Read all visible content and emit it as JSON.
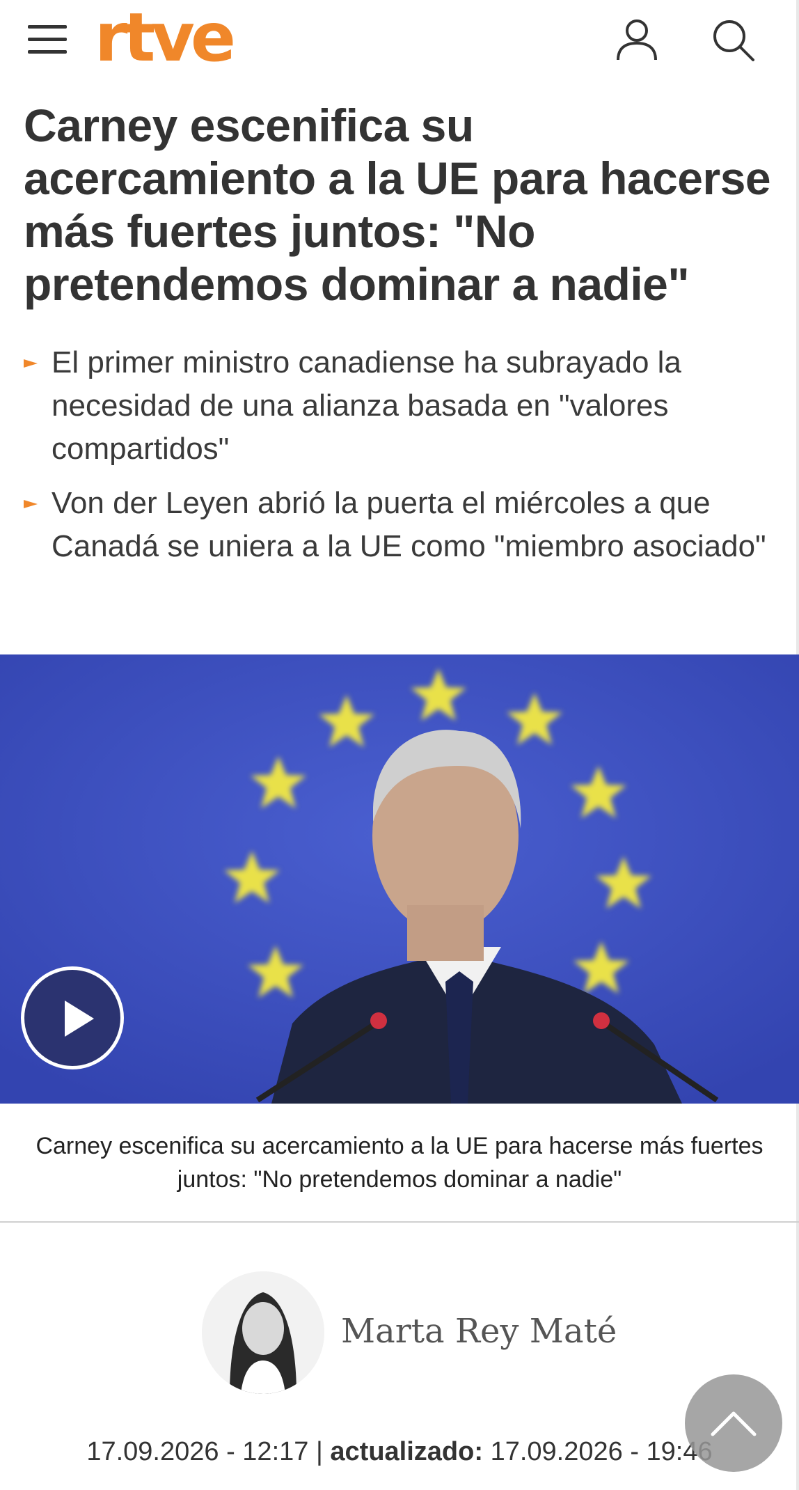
{
  "header": {
    "logo_text": "rtve",
    "menu_icon": "hamburger-menu-icon",
    "user_icon": "user-account-icon",
    "search_icon": "search-icon",
    "brand_color": "#f0872a"
  },
  "article": {
    "headline": "Carney escenifica su acercamiento a la UE para hacerse más fuertes juntos: \"No pretendemos dominar a nadie\"",
    "bullets": [
      "El primer ministro canadiense ha subrayado la necesidad de una alianza basada en \"valores compartidos\"",
      "Von der Leyen abrió la puerta el miércoles a que Canadá se uniera a la UE como \"miembro asociado\""
    ],
    "media": {
      "play_icon": "play-icon",
      "caption": "Carney escenifica su acercamiento a la UE para hacerse más fuertes juntos: \"No pretendemos dominar a nadie\""
    },
    "author": {
      "name": "Marta Rey Maté"
    },
    "dates": {
      "published": "17.09.2026 - 12:17",
      "separator": "|",
      "updated_label": "actualizado:",
      "updated": "17.09.2026 - 19:46"
    }
  },
  "scroll_top_icon": "chevron-up-icon"
}
